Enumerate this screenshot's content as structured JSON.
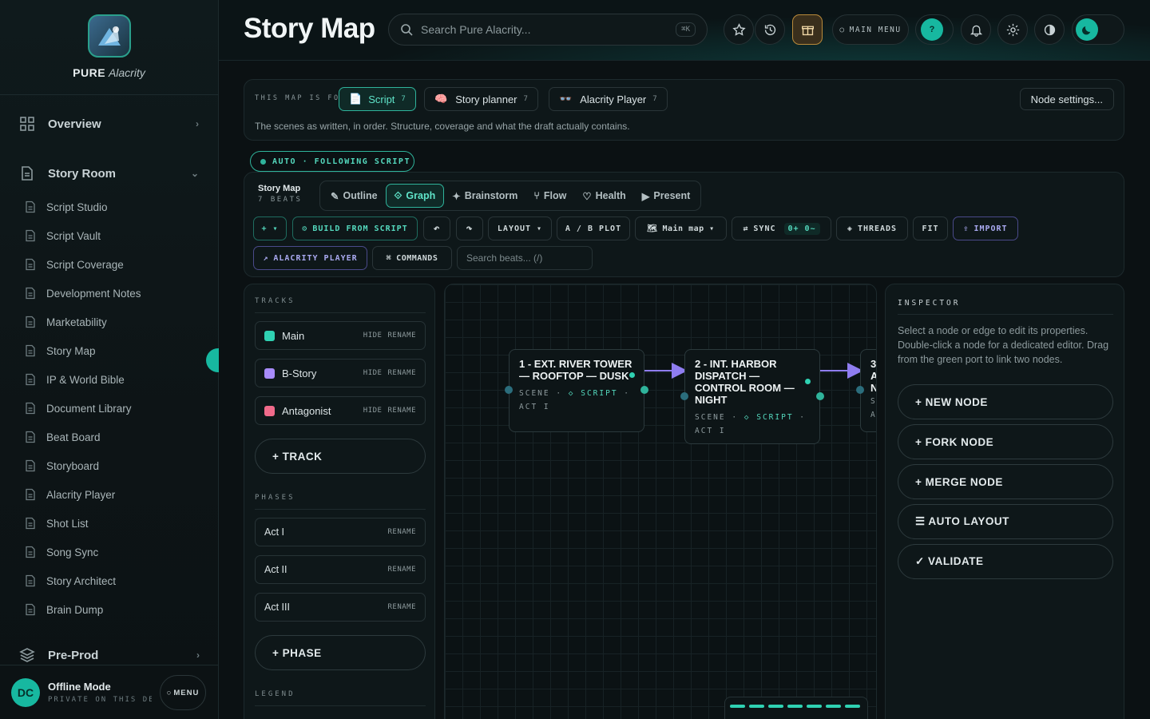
{
  "brand": {
    "bold": "PURE",
    "italic": "Alacrity"
  },
  "sidebar": {
    "overview": "Overview",
    "story_room": "Story Room",
    "items": [
      "Script Studio",
      "Script Vault",
      "Script Coverage",
      "Development Notes",
      "Marketability",
      "Story Map",
      "IP & World Bible",
      "Document Library",
      "Beat Board",
      "Storyboard",
      "Alacrity Player",
      "Shot List",
      "Song Sync",
      "Story Architect",
      "Brain Dump"
    ],
    "pre_prod": "Pre-Prod",
    "user": {
      "initials": "DC",
      "status": "Offline Mode",
      "sub": "PRIVATE ON THIS DEVICE",
      "menu": "MENU"
    }
  },
  "header": {
    "title": "Story Map",
    "search_placeholder": "Search Pure Alacrity...",
    "search_shortcut": "⌘K",
    "main_menu": "MAIN MENU",
    "help": "?"
  },
  "context": {
    "label": "THIS MAP IS FOR",
    "chips": [
      {
        "label": "Script",
        "count": "7"
      },
      {
        "label": "Story planner",
        "count": "7"
      },
      {
        "label": "Alacrity Player",
        "count": "7"
      }
    ],
    "node_settings": "Node settings...",
    "description": "The scenes as written, in order. Structure, coverage and what the draft actually contains."
  },
  "auto_badge": "AUTO · FOLLOWING SCRIPT",
  "toolbar": {
    "title": "Story Map",
    "subtitle": "7 BEATS",
    "modes": [
      "Outline",
      "Graph",
      "Brainstorm",
      "Flow",
      "Health",
      "Present"
    ],
    "add": "+ ▾",
    "build": "BUILD FROM SCRIPT",
    "undo": "↶",
    "redo": "↷",
    "layout": "LAYOUT ▾",
    "ab_plot": "A / B PLOT",
    "main_map": "Main map ▾",
    "sync": "SYNC",
    "sync_counts": "0+ 0~",
    "threads": "THREADS",
    "fit": "FIT",
    "import": "IMPORT",
    "alacrity_player": "ALACRITY PLAYER",
    "commands": "COMMANDS",
    "beat_search_placeholder": "Search beats... (/)"
  },
  "tracks_panel": {
    "tracks_label": "TRACKS",
    "tracks": [
      {
        "name": "Main",
        "color": "#2fd1b2"
      },
      {
        "name": "B-Story",
        "color": "#a78bfa"
      },
      {
        "name": "Antagonist",
        "color": "#f06a8a"
      }
    ],
    "hide": "HIDE",
    "rename": "RENAME",
    "add_track": "+ TRACK",
    "phases_label": "PHASES",
    "phases": [
      "Act I",
      "Act II",
      "Act III"
    ],
    "add_phase": "+ PHASE",
    "legend_label": "LEGEND"
  },
  "canvas": {
    "nodes": [
      {
        "title": "1 - EXT. RIVER TOWER — ROOFTOP — DUSK",
        "kind": "SCENE",
        "source": "◇ SCRIPT",
        "act": "ACT I"
      },
      {
        "title": "2 - INT. HARBOR DISPATCH — CONTROL ROOM — NIGHT",
        "kind": "SCENE",
        "source": "◇ SCRIPT",
        "act": "ACT I"
      },
      {
        "title": "3 A N",
        "kind": "S",
        "source": "",
        "act": "A"
      }
    ],
    "minimap_segments": 7
  },
  "inspector": {
    "title": "INSPECTOR",
    "description": "Select a node or edge to edit its properties. Double-click a node for a dedicated editor. Drag from the green port to link two nodes.",
    "buttons": [
      "+ NEW NODE",
      "+ FORK NODE",
      "+ MERGE NODE",
      "☰ AUTO LAYOUT",
      "✓ VALIDATE"
    ]
  },
  "colors": {
    "accent": "#2fd1b2",
    "purple": "#a78bfa",
    "pink": "#f06a8a",
    "bg": "#0b1113"
  }
}
